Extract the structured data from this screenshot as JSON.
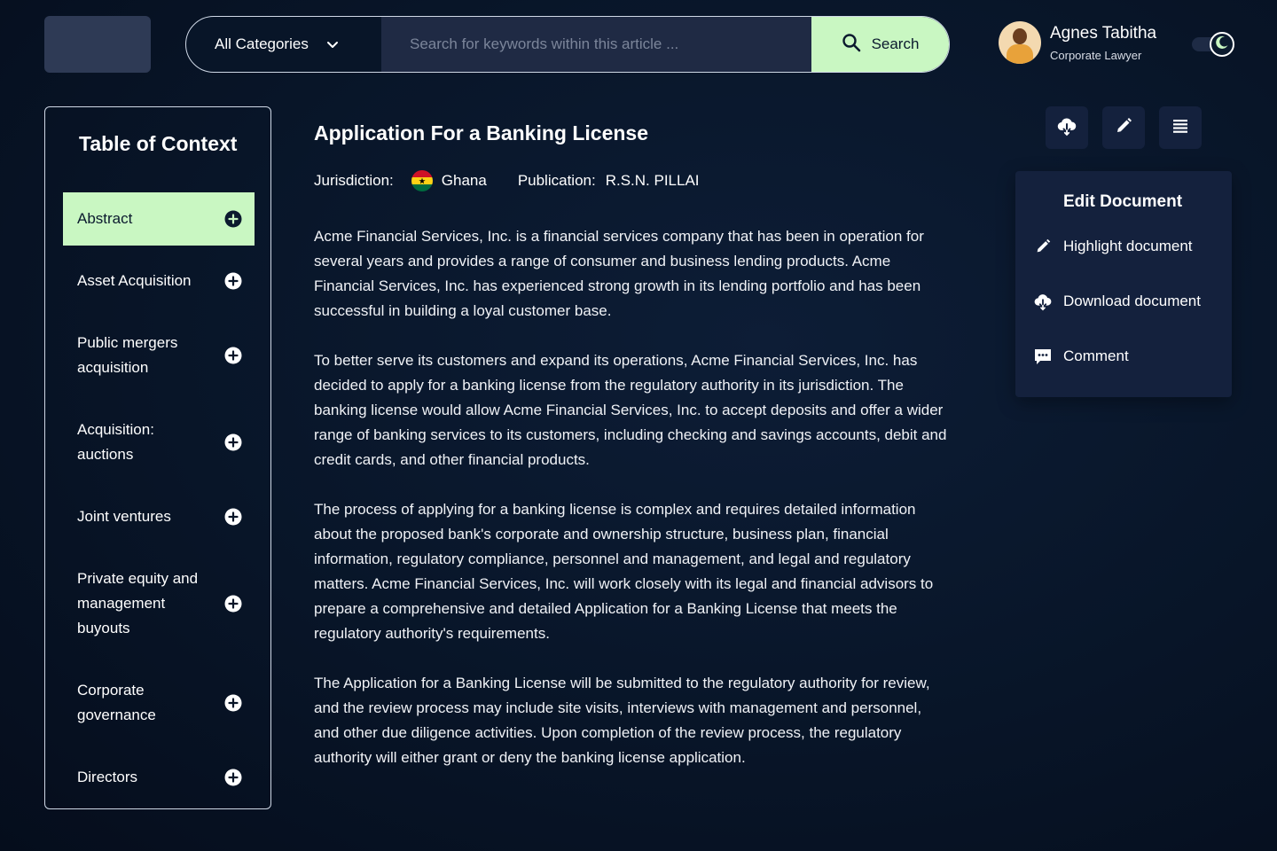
{
  "header": {
    "category_label": "All Categories",
    "search_placeholder": "Search for keywords within this article ...",
    "search_button": "Search",
    "user_name": "Agnes Tabitha",
    "user_role": "Corporate Lawyer"
  },
  "toc": {
    "title": "Table of Context",
    "items": [
      {
        "label": "Abstract",
        "active": true
      },
      {
        "label": "Asset Acquisition"
      },
      {
        "label": "Public mergers acquisition"
      },
      {
        "label": "Acquisition: auctions"
      },
      {
        "label": "Joint ventures"
      },
      {
        "label": "Private equity and management buyouts"
      },
      {
        "label": "Corporate governance"
      },
      {
        "label": "Directors"
      }
    ]
  },
  "document": {
    "title": "Application For a Banking License",
    "jurisdiction_label": "Jurisdiction:",
    "jurisdiction_value": "Ghana",
    "publication_label": "Publication:",
    "publication_value": "R.S.N. PILLAI",
    "paragraphs": [
      "Acme Financial Services, Inc. is a financial services company that has been in operation for several years and provides a range of consumer and business lending products. Acme Financial Services, Inc. has experienced strong growth in its lending portfolio and has been successful in building a loyal customer base.",
      "To better serve its customers and expand its operations, Acme Financial Services, Inc. has decided to apply for a banking license from the regulatory authority in its jurisdiction. The banking license would allow Acme Financial Services, Inc. to accept deposits and offer a wider range of banking services to its customers, including checking and savings accounts, debit and credit cards, and other financial products.",
      "The process of applying for a banking license is complex and requires detailed information about the proposed bank's corporate and ownership structure, business plan, financial information, regulatory compliance, personnel and management, and legal and regulatory matters. Acme Financial Services, Inc. will work closely with its legal and financial advisors to prepare a comprehensive and detailed Application for a Banking License that meets the regulatory authority's requirements.",
      "The Application for a Banking License will be submitted to the regulatory authority for review, and the review process may include site visits, interviews with management and personnel, and other due diligence activities. Upon completion of the review process, the regulatory authority will either grant or deny the banking license application."
    ]
  },
  "edit_panel": {
    "title": "Edit Document",
    "items": [
      {
        "label": "Highlight document",
        "icon": "pencil-icon"
      },
      {
        "label": "Download document",
        "icon": "cloud-download-icon"
      },
      {
        "label": "Comment",
        "icon": "comment-icon"
      }
    ]
  },
  "colors": {
    "background": "#081528",
    "accent": "#c9f7c2",
    "panel": "#14213d",
    "input": "#1f2a44"
  }
}
